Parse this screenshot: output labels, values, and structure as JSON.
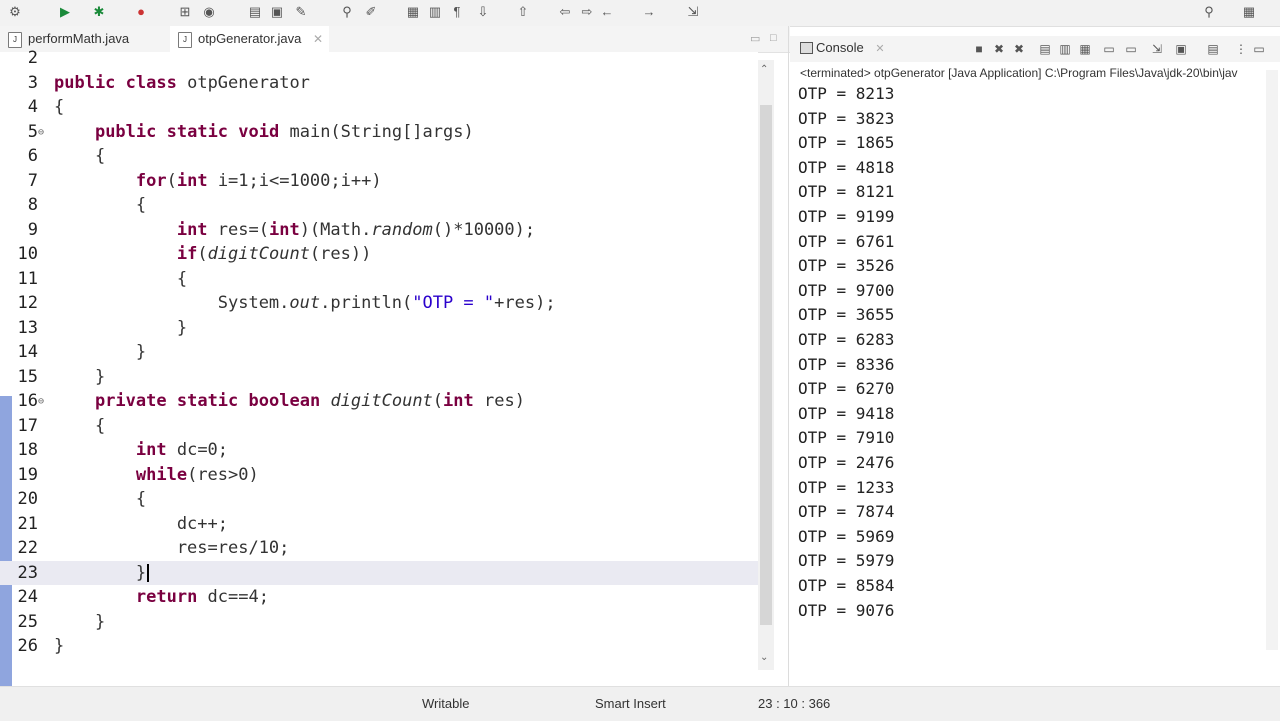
{
  "toolbar": {
    "icons": [
      "gear-icon",
      "run-icon",
      "debug-icon",
      "coverage-icon",
      "new-icon",
      "open-icon",
      "save-icon",
      "search-icon",
      "pen-icon",
      "annotation-icon",
      "pilcrow-icon",
      "down-arrow-icon",
      "up-arrow-icon",
      "back-icon",
      "forward-icon",
      "pin-icon",
      "global-search-icon",
      "perspective-icon"
    ]
  },
  "editor": {
    "tabs": [
      {
        "label": "performMath.java",
        "active": false
      },
      {
        "label": "otpGenerator.java",
        "active": true,
        "close": "✕"
      }
    ],
    "lines": [
      {
        "num": "2",
        "text": ""
      },
      {
        "num": "3",
        "text": "public class otpGenerator"
      },
      {
        "num": "4",
        "text": "{"
      },
      {
        "num": "5",
        "text": "    public static void main(String[]args)"
      },
      {
        "num": "6",
        "text": "    {"
      },
      {
        "num": "7",
        "text": "        for(int i=1;i<=1000;i++)"
      },
      {
        "num": "8",
        "text": "        {"
      },
      {
        "num": "9",
        "text": "            int res=(int)(Math.random()*10000);"
      },
      {
        "num": "10",
        "text": "            if(digitCount(res))"
      },
      {
        "num": "11",
        "text": "            {"
      },
      {
        "num": "12",
        "text": "                System.out.println(\"OTP = \"+res);"
      },
      {
        "num": "13",
        "text": "            }"
      },
      {
        "num": "14",
        "text": "        }"
      },
      {
        "num": "15",
        "text": "    }"
      },
      {
        "num": "16",
        "text": "    private static boolean digitCount(int res)"
      },
      {
        "num": "17",
        "text": "    {"
      },
      {
        "num": "18",
        "text": "        int dc=0;"
      },
      {
        "num": "19",
        "text": "        while(res>0)"
      },
      {
        "num": "20",
        "text": "        {"
      },
      {
        "num": "21",
        "text": "            dc++;"
      },
      {
        "num": "22",
        "text": "            res=res/10;"
      },
      {
        "num": "23",
        "text": "        }"
      },
      {
        "num": "24",
        "text": "        return dc==4;"
      },
      {
        "num": "25",
        "text": "    }"
      },
      {
        "num": "26",
        "text": "}"
      }
    ]
  },
  "console": {
    "tab_label": "Console",
    "close": "✕",
    "status": "<terminated> otpGenerator [Java Application] C:\\Program Files\\Java\\jdk-20\\bin\\jav",
    "output": [
      "OTP = 8213",
      "OTP = 3823",
      "OTP = 1865",
      "OTP = 4818",
      "OTP = 8121",
      "OTP = 9199",
      "OTP = 6761",
      "OTP = 3526",
      "OTP = 9700",
      "OTP = 3655",
      "OTP = 6283",
      "OTP = 8336",
      "OTP = 6270",
      "OTP = 9418",
      "OTP = 7910",
      "OTP = 2476",
      "OTP = 1233",
      "OTP = 7874",
      "OTP = 5969",
      "OTP = 5979",
      "OTP = 8584",
      "OTP = 9076"
    ]
  },
  "statusbar": {
    "mode": "Writable",
    "insert": "Smart Insert",
    "position": "23 : 10 : 366"
  }
}
